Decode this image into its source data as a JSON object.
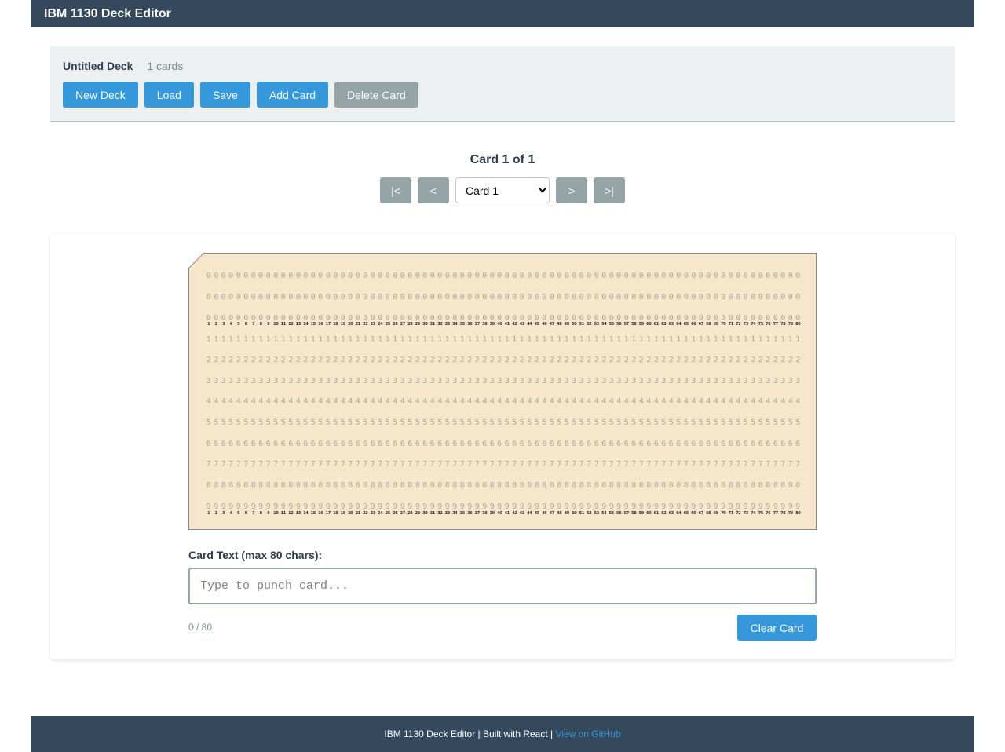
{
  "header": {
    "title": "IBM 1130 Deck Editor"
  },
  "toolbar": {
    "deck_name": "Untitled Deck",
    "card_count": "1 cards",
    "buttons": {
      "new_deck": "New Deck",
      "load": "Load",
      "save": "Save",
      "add_card": "Add Card",
      "delete_card": "Delete Card"
    }
  },
  "navigation": {
    "title": "Card 1 of 1",
    "first": "|<",
    "prev": "<",
    "next": ">",
    "last": ">|",
    "select_value": "Card 1",
    "options": [
      "Card 1"
    ]
  },
  "punch_card": {
    "rows": [
      "",
      "",
      "0",
      "1",
      "2",
      "3",
      "4",
      "5",
      "6",
      "7",
      "8",
      "9"
    ],
    "blank_row_glyph": "0",
    "columns": 80
  },
  "editor": {
    "label": "Card Text (max 80 chars):",
    "value": "",
    "placeholder": "Type to punch card...",
    "char_count": "0 / 80",
    "clear_label": "Clear Card"
  },
  "footer": {
    "text": "IBM 1130 Deck Editor | Built with React |",
    "link_text": "View on GitHub"
  },
  "colors": {
    "header_bg": "#34495e",
    "primary": "#3498db",
    "disabled": "#95a5a6",
    "toolbar_bg": "#ecf0f1",
    "card_bg": "#f5e6cc"
  },
  "icons": {
    "select_caret": "chevron-down-icon"
  }
}
